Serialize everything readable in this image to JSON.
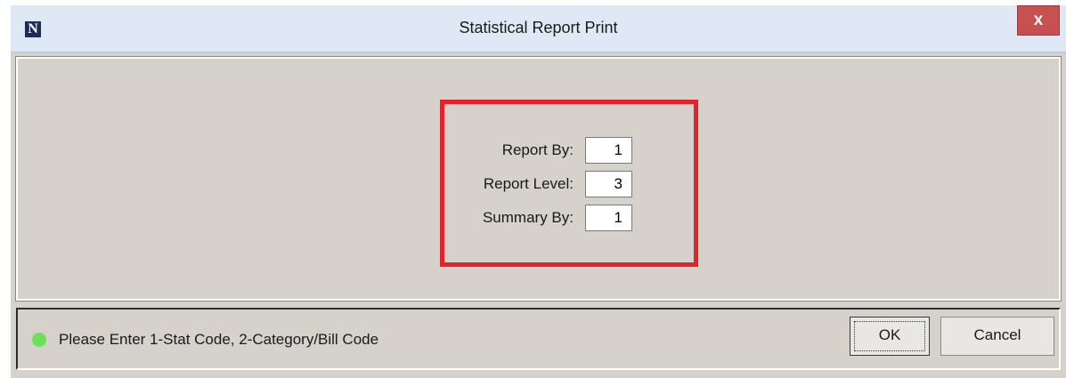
{
  "window": {
    "title": "Statistical Report Print",
    "logo_letter": "N",
    "close_label": "x"
  },
  "fields": [
    {
      "label": "Report By:",
      "value": "1"
    },
    {
      "label": "Report Level:",
      "value": "3"
    },
    {
      "label": "Summary By:",
      "value": "1"
    }
  ],
  "status": {
    "message": "Please Enter 1-Stat Code, 2-Category/Bill Code",
    "indicator_color": "#6de05a"
  },
  "buttons": {
    "ok_label": "OK",
    "cancel_label": "Cancel"
  },
  "colors": {
    "highlight": "#e3222a",
    "titlebar": "#dfe9f5",
    "close": "#c75050",
    "dialog_bg": "#d6d2cb"
  }
}
